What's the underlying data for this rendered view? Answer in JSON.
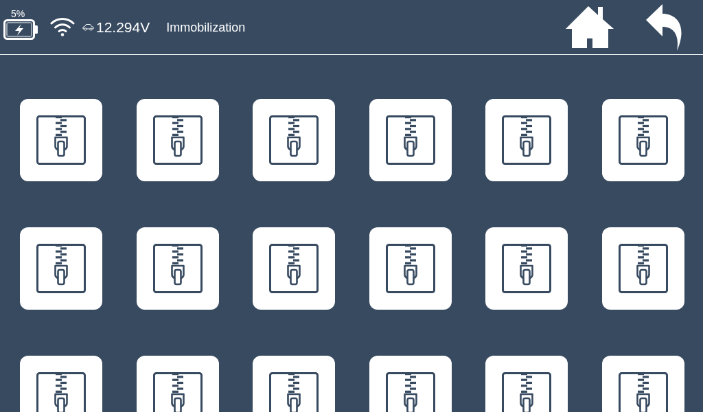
{
  "status_bar": {
    "battery": {
      "percent": "5%",
      "charging": true
    },
    "voltage": "12.294V",
    "title": "Immobilization"
  },
  "nav_buttons": [
    {
      "kind": "home"
    },
    {
      "kind": "back"
    }
  ],
  "tiles": [
    {
      "kind": "archive"
    },
    {
      "kind": "archive"
    },
    {
      "kind": "archive"
    },
    {
      "kind": "archive"
    },
    {
      "kind": "archive"
    },
    {
      "kind": "archive"
    },
    {
      "kind": "archive"
    },
    {
      "kind": "archive"
    },
    {
      "kind": "archive"
    },
    {
      "kind": "archive"
    },
    {
      "kind": "archive"
    },
    {
      "kind": "archive"
    },
    {
      "kind": "archive"
    },
    {
      "kind": "archive"
    },
    {
      "kind": "archive"
    },
    {
      "kind": "archive"
    },
    {
      "kind": "archive"
    },
    {
      "kind": "archive"
    }
  ]
}
